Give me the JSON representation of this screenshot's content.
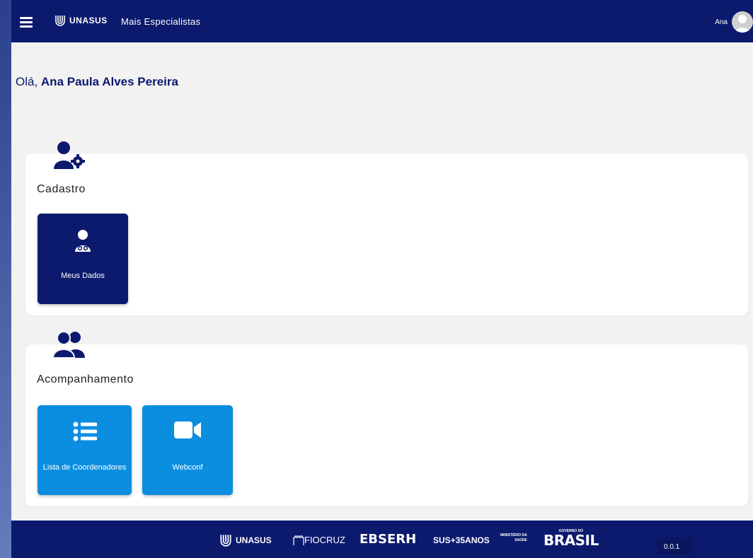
{
  "topbar": {
    "brand": "UNASUS",
    "title": "Mais Especialistas",
    "user_name": "Ana"
  },
  "greeting": {
    "prefix": "Olá, ",
    "name": "Ana Paula Alves Pereira"
  },
  "sections": [
    {
      "title": "Cadastro",
      "icon": "user-gear-icon",
      "tiles": [
        {
          "label": "Meus Dados",
          "icon": "user-doctor-icon"
        }
      ]
    },
    {
      "title": "Acompanhamento",
      "icon": "users-icon",
      "tiles": [
        {
          "label": "Lista de Coordenadores",
          "icon": "list-icon"
        },
        {
          "label": "Webconf",
          "icon": "video-camera-icon"
        }
      ]
    }
  ],
  "footer": {
    "logos": {
      "unasus": "UNASUS",
      "fiocruz": "FIOCRUZ",
      "ebserh": "EBSERH",
      "sus": "SUS+35ANOS",
      "ministerio_line1": "MINISTÉRIO DA",
      "ministerio_line2": "SAÚDE",
      "governo": "GOVERNO DO",
      "brasil": "BRASIL"
    },
    "version": "0.0.1"
  },
  "colors": {
    "primary": "#0c1a6e",
    "accent": "#0b8ee0",
    "background": "#f2f2f2"
  }
}
